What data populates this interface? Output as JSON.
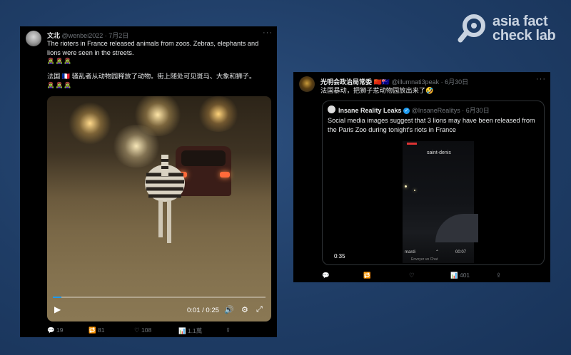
{
  "logo": {
    "line1": "asia fact",
    "line2": "check lab"
  },
  "tweet1": {
    "name": "文北",
    "handle": "@wenbei2022",
    "date": "· 7月2日",
    "text_en": "The rioters in France released animals from zoos. Zebras, elephants and lions were seen in the streets.",
    "emoji_en": "🧟‍♀️🧟‍♀️🧟‍♀️",
    "text_zh": "法国 🇫🇷 骚乱者从动物园释放了动物。街上随处可见斑马、大象和狮子。",
    "emoji_zh": "🧟‍♀️🧟‍♀️🧟‍♀️",
    "video_time": "0:01 / 0:25",
    "video_progress": 0.04,
    "actions": {
      "replies": "19",
      "retweets": "81",
      "likes": "108",
      "views": "1.1萬"
    }
  },
  "tweet2": {
    "name": "光明会政治局常委",
    "flags": "🇨🇳🇦🇺",
    "handle": "@illumnati3peak",
    "date": "· 6月30日",
    "text": "法国暴动，把狮子惹动物园放出来了🤣",
    "quote": {
      "name": "Insane Reality Leaks",
      "handle": "@InsaneRealitys",
      "date": "· 6月30日",
      "text": "Social media images suggest that 3 lions may have been released from the Paris Zoo during tonight's riots in France",
      "video_duration": "0:35",
      "phone_caption": "saint-denis",
      "phone_bottom_left": "mardi",
      "phone_bottom_right": "00:07",
      "phone_send": "Envoyer un Chat"
    },
    "actions": {
      "views": "401"
    }
  },
  "colors": {
    "accent": "#1d9bf0",
    "background": "#1f3d66"
  }
}
